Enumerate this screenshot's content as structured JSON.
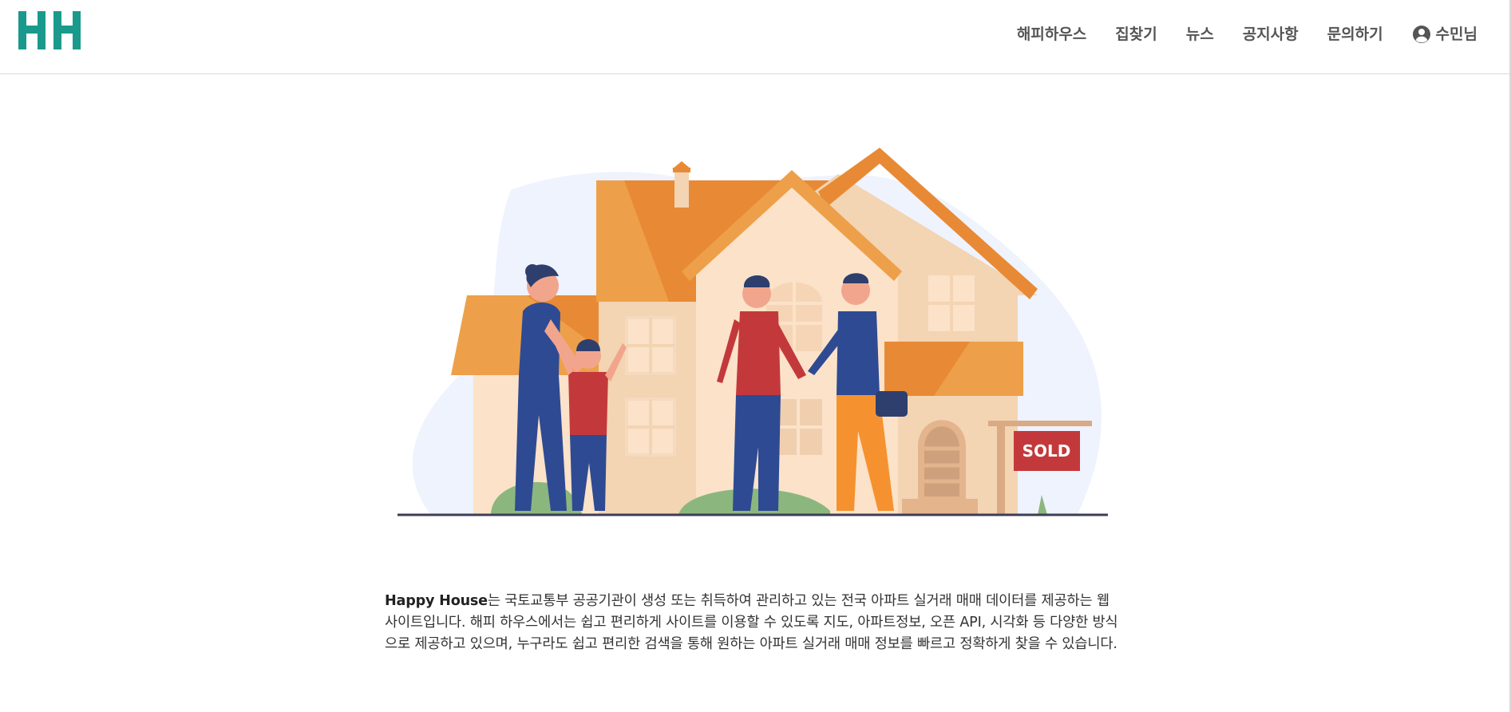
{
  "header": {
    "logo_text": "HH",
    "nav": [
      {
        "label": "해피하우스"
      },
      {
        "label": "집찾기"
      },
      {
        "label": "뉴스"
      },
      {
        "label": "공지사항"
      },
      {
        "label": "문의하기"
      }
    ],
    "user_label": "수민님",
    "user_icon": "account-circle-icon"
  },
  "hero": {
    "sign_text": "SOLD"
  },
  "intro": {
    "brand": "Happy House",
    "text": "는 국토교통부 공공기관이 생성 또는 취득하여 관리하고 있는 전국 아파트 실거래 매매 데이터를 제공하는 웹사이트입니다. 해피 하우스에서는 쉽고 편리하게 사이트를 이용할 수 있도록 지도, 아파트정보, 오픈 API, 시각화 등 다양한 방식으로 제공하고 있으며, 누구라도 쉽고 편리한 검색을 통해 원하는 아파트 실거래 매매 정보를 빠르고 정확하게 찾을 수 있습니다."
  },
  "colors": {
    "brand_teal": "#1a9a8c",
    "roof_orange": "#e88a35",
    "wall_peach": "#f3d4b3",
    "sign_red": "#c3393b"
  }
}
